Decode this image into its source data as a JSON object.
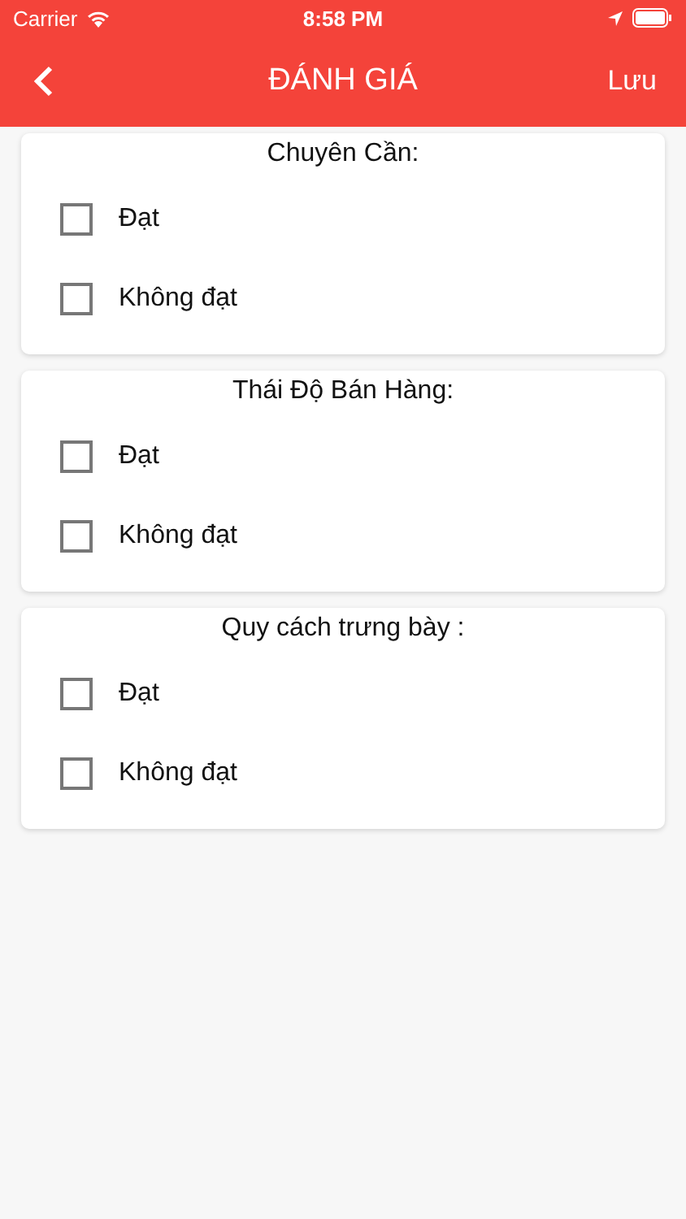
{
  "status_bar": {
    "carrier": "Carrier",
    "time": "8:58 PM"
  },
  "nav": {
    "title": "ĐÁNH GIÁ",
    "action": "Lưu"
  },
  "sections": [
    {
      "title": "Chuyên Cần:",
      "options": [
        {
          "label": "Đạt",
          "checked": false
        },
        {
          "label": "Không đạt",
          "checked": false
        }
      ]
    },
    {
      "title": "Thái Độ Bán Hàng:",
      "options": [
        {
          "label": "Đạt",
          "checked": false
        },
        {
          "label": "Không đạt",
          "checked": false
        }
      ]
    },
    {
      "title": "Quy cách trưng bày :",
      "options": [
        {
          "label": "Đạt",
          "checked": false
        },
        {
          "label": "Không đạt",
          "checked": false
        }
      ]
    }
  ]
}
